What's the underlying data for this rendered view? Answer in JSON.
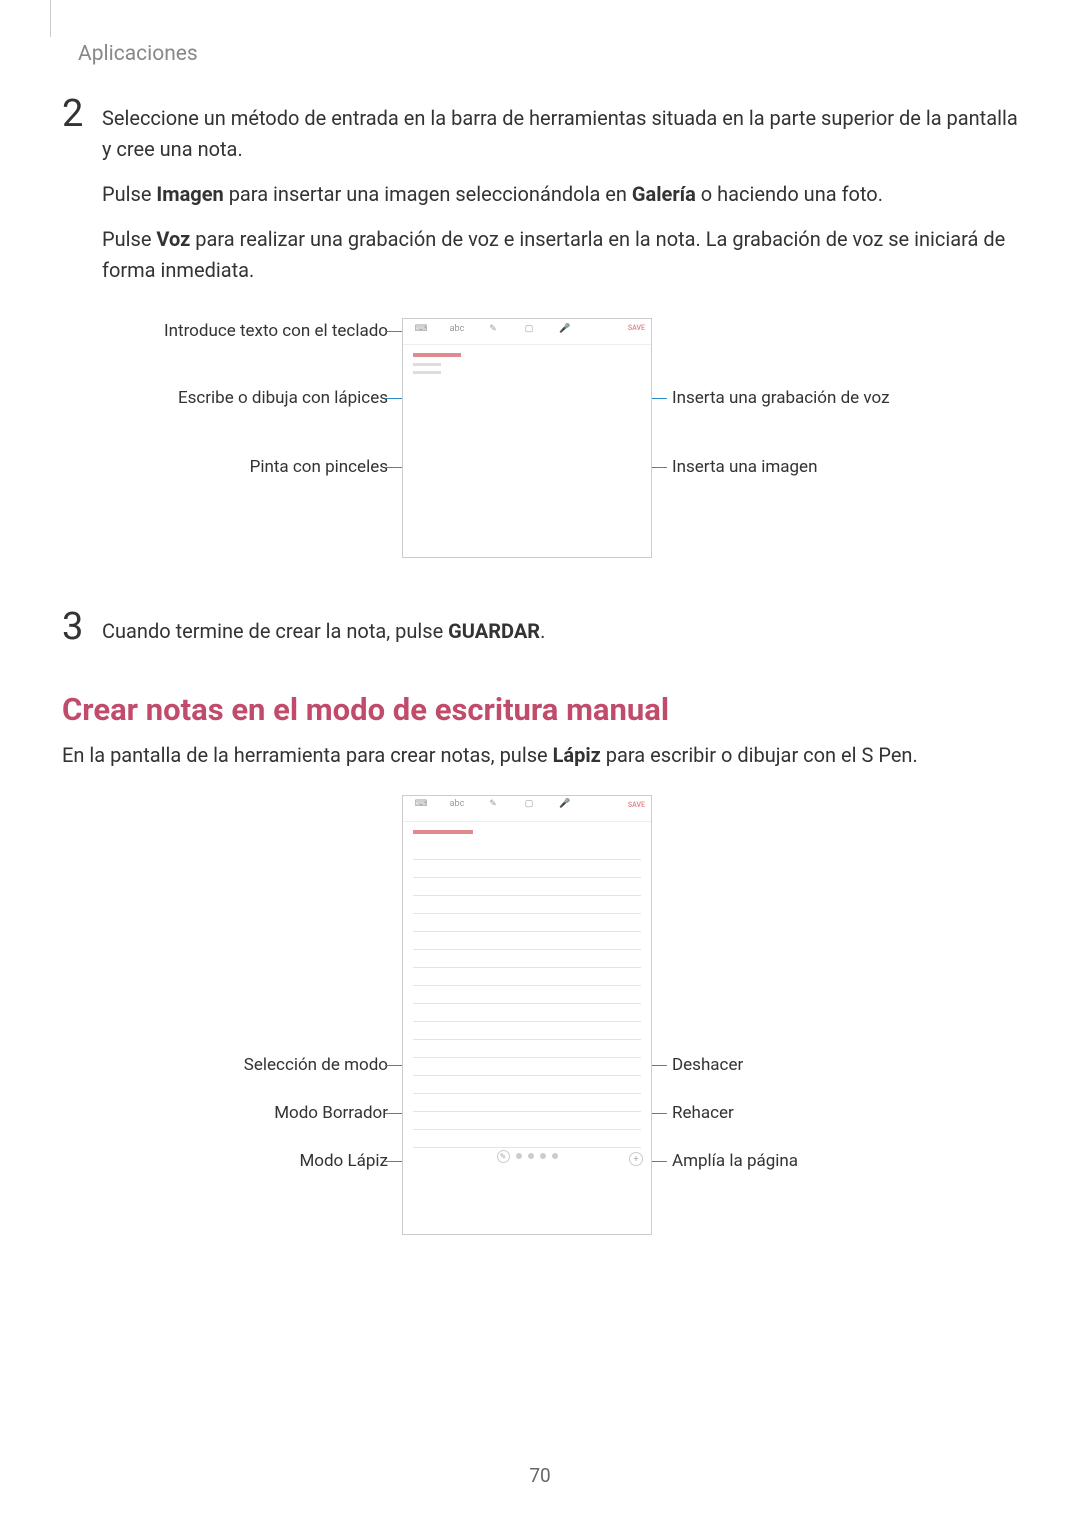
{
  "breadcrumb": "Aplicaciones",
  "step2": {
    "num": "2",
    "p1_a": "Seleccione un método de entrada en la barra de herramientas situada en la parte superior de la pantalla y cree una nota.",
    "p2_a": "Pulse ",
    "p2_b": "Imagen",
    "p2_c": " para insertar una imagen seleccionándola en ",
    "p2_d": "Galería",
    "p2_e": " o haciendo una foto.",
    "p3_a": "Pulse ",
    "p3_b": "Voz",
    "p3_c": " para realizar una grabación de voz e insertarla en la nota. La grabación de voz se iniciará de forma inmediata."
  },
  "diagram1": {
    "left1": "Introduce texto con el teclado",
    "left2": "Escribe o dibuja con lápices",
    "left3": "Pinta con pinceles",
    "right1": "Inserta una grabación de voz",
    "right2": "Inserta una imagen",
    "save": "SAVE"
  },
  "step3": {
    "num": "3",
    "text_a": "Cuando termine de crear la nota, pulse ",
    "text_b": "GUARDAR",
    "text_c": "."
  },
  "heading": "Crear notas en el modo de escritura manual",
  "body": {
    "a": "En la pantalla de la herramienta para crear notas, pulse ",
    "b": "Lápiz",
    "c": " para escribir o dibujar con el S Pen."
  },
  "diagram2": {
    "left1": "Selección de modo",
    "left2": "Modo Borrador",
    "left3": "Modo Lápiz",
    "right1": "Deshacer",
    "right2": "Rehacer",
    "right3": "Amplía la página",
    "save": "SAVE"
  },
  "pagenum": "70",
  "toolbar_labels": {
    "abc": "abc"
  }
}
